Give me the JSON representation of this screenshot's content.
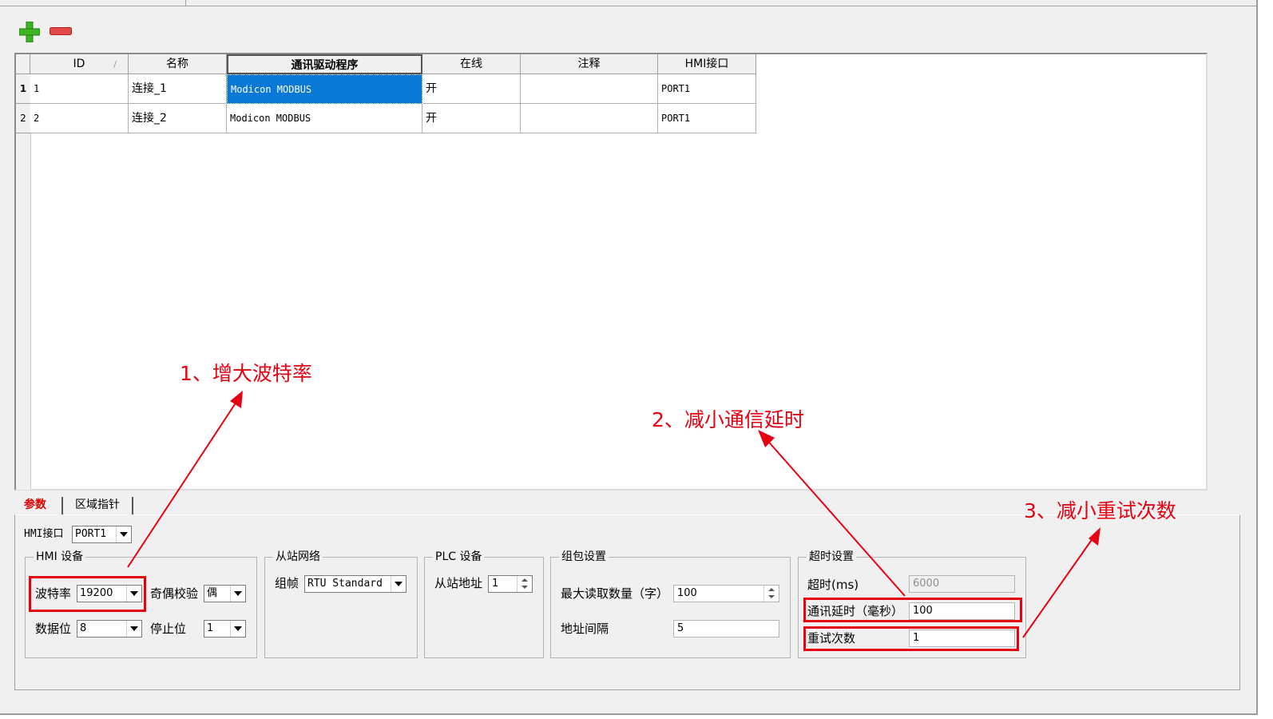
{
  "toolbar": {
    "add_icon": "add-icon",
    "remove_icon": "remove-icon",
    "add_color": "#3cb521",
    "remove_color": "#e34a4a"
  },
  "grid": {
    "columns": [
      "ID",
      "名称",
      "通讯驱动程序",
      "在线",
      "注释",
      "HMI接口"
    ],
    "rows": [
      {
        "row_no": "1",
        "id": "1",
        "name": "连接_1",
        "driver": "Modicon MODBUS",
        "online": "开",
        "comment": "",
        "hmi_port": "PORT1"
      },
      {
        "row_no": "2",
        "id": "2",
        "name": "连接_2",
        "driver": "Modicon MODBUS",
        "online": "开",
        "comment": "",
        "hmi_port": "PORT1"
      }
    ],
    "selected_color": "#0a78d7"
  },
  "tabs": {
    "params": "参数",
    "area_pointer": "区域指针"
  },
  "hmi_port": {
    "label": "HMI接口",
    "value": "PORT1"
  },
  "hmi_device": {
    "title": "HMI 设备",
    "baud_label": "波特率",
    "baud_value": "19200",
    "parity_label": "奇偶校验",
    "parity_value": "偶",
    "databits_label": "数据位",
    "databits_value": "8",
    "stopbits_label": "停止位",
    "stopbits_value": "1"
  },
  "slave_network": {
    "title": "从站网络",
    "frame_label": "组帧",
    "frame_value": "RTU Standard"
  },
  "plc_device": {
    "title": "PLC 设备",
    "slave_addr_label": "从站地址",
    "slave_addr_value": "1"
  },
  "packet": {
    "title": "组包设置",
    "max_read_label": "最大读取数量（字）",
    "max_read_value": "100",
    "addr_gap_label": "地址间隔",
    "addr_gap_value": "5"
  },
  "timeout": {
    "title": "超时设置",
    "timeout_label": "超时(ms)",
    "timeout_value": "6000",
    "delay_label": "通讯延时（毫秒）",
    "delay_value": "100",
    "retry_label": "重试次数",
    "retry_value": "1"
  },
  "annotations": {
    "a1": "1、增大波特率",
    "a2": "2、减小通信延时",
    "a3": "3、减小重试次数",
    "color": "#e60012"
  }
}
